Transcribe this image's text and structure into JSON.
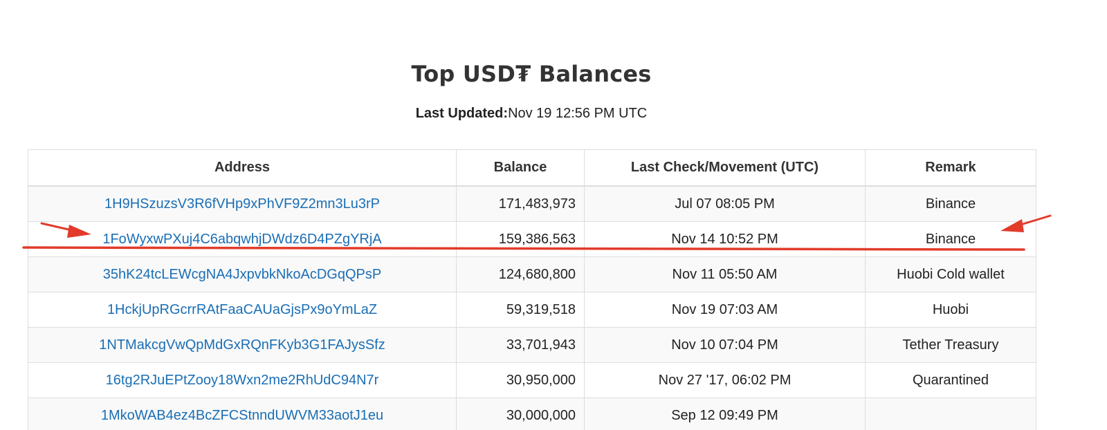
{
  "header": {
    "title": "Top USD₮ Balances",
    "updated_label": "Last Updated:",
    "updated_value": "Nov 19 12:56 PM UTC"
  },
  "table": {
    "columns": [
      "Address",
      "Balance",
      "Last Check/Movement (UTC)",
      "Remark"
    ],
    "rows": [
      {
        "address": "1H9HSzuzsV3R6fVHp9xPhVF9Z2mn3Lu3rP",
        "balance": "171,483,973",
        "date": "Jul 07 08:05 PM",
        "remark": "Binance"
      },
      {
        "address": "1FoWyxwPXuj4C6abqwhjDWdz6D4PZgYRjA",
        "balance": "159,386,563",
        "date": "Nov 14 10:52 PM",
        "remark": "Binance"
      },
      {
        "address": "35hK24tcLEWcgNA4JxpvbkNkoAcDGqQPsP",
        "balance": "124,680,800",
        "date": "Nov 11 05:50 AM",
        "remark": "Huobi Cold wallet"
      },
      {
        "address": "1HckjUpRGcrrRAtFaaCAUaGjsPx9oYmLaZ",
        "balance": "59,319,518",
        "date": "Nov 19 07:03 AM",
        "remark": "Huobi"
      },
      {
        "address": "1NTMakcgVwQpMdGxRQnFKyb3G1FAJysSfz",
        "balance": "33,701,943",
        "date": "Nov 10 07:04 PM",
        "remark": "Tether Treasury"
      },
      {
        "address": "16tg2RJuEPtZooy18Wxn2me2RhUdC94N7r",
        "balance": "30,950,000",
        "date": "Nov 27 '17, 06:02 PM",
        "remark": "Quarantined"
      },
      {
        "address": "1MkoWAB4ez4BcZFCStnndUWVM33aotJ1eu",
        "balance": "30,000,000",
        "date": "Sep 12 09:49 PM",
        "remark": ""
      }
    ]
  },
  "annotations": {
    "color": "#e23b2a"
  }
}
